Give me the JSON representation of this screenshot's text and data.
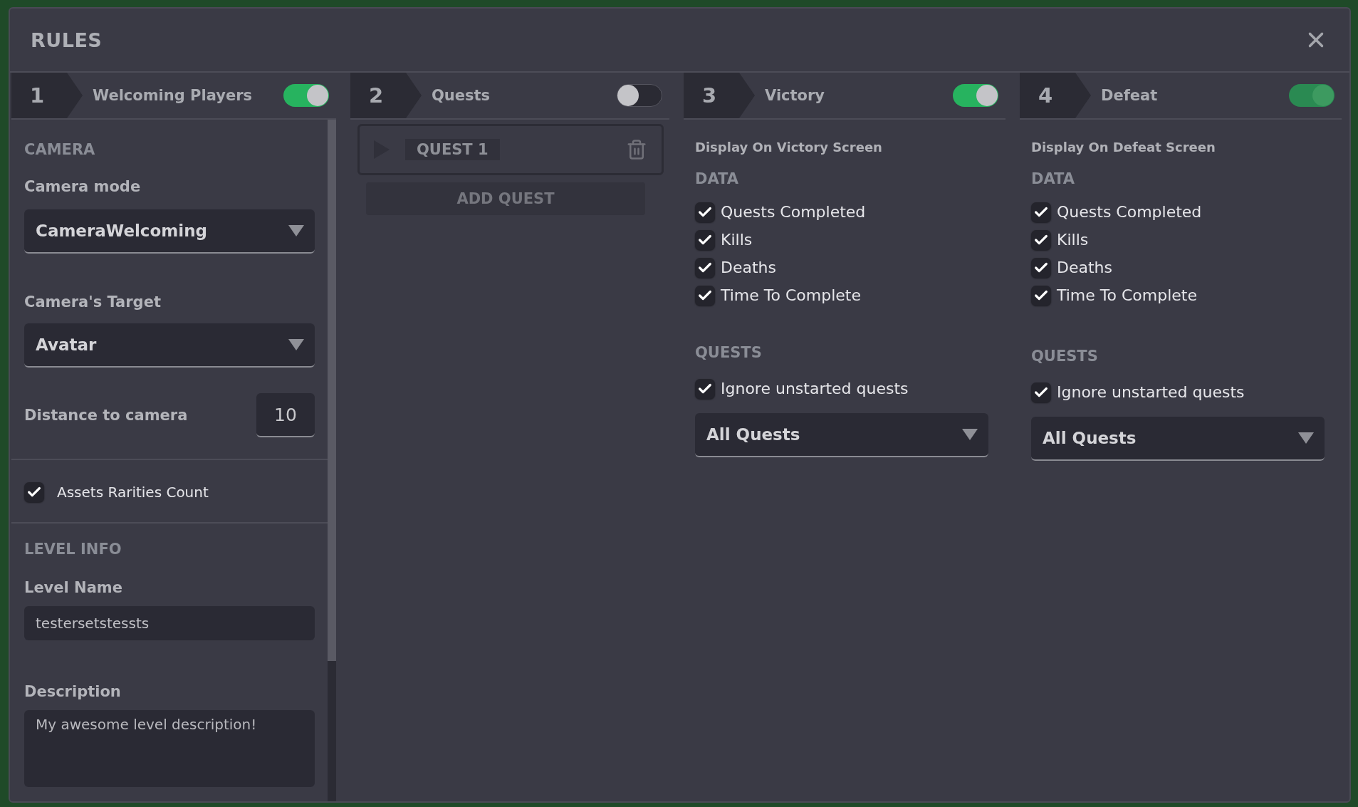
{
  "window": {
    "title": "RULES"
  },
  "steps": [
    {
      "number": "1",
      "title": "Welcoming Players",
      "on": true,
      "disabled": false,
      "kind": "welcoming",
      "panel": {
        "camera_heading": "CAMERA",
        "camera_mode": {
          "label": "Camera mode",
          "value": "CameraWelcoming"
        },
        "camera_target": {
          "label": "Camera's Target",
          "value": "Avatar"
        },
        "distance": {
          "label": "Distance to camera",
          "value": "10"
        },
        "assets_rarities": {
          "label": "Assets Rarities Count",
          "checked": true
        },
        "level_heading": "LEVEL INFO",
        "level_name": {
          "label": "Level Name",
          "value": "testersetstessts"
        },
        "description": {
          "label": "Description",
          "value": "My awesome level description!"
        }
      }
    },
    {
      "number": "2",
      "title": "Quests",
      "on": false,
      "disabled": false,
      "kind": "quests",
      "panel": {
        "quests": [
          {
            "label": "QUEST 1"
          }
        ],
        "add_button": "ADD QUEST"
      }
    },
    {
      "number": "3",
      "title": "Victory",
      "on": true,
      "disabled": false,
      "kind": "screen",
      "panel": {
        "subtitle": "Display On Victory Screen",
        "data_heading": "DATA",
        "data_options": [
          {
            "label": "Quests Completed",
            "checked": true
          },
          {
            "label": "Kills",
            "checked": true
          },
          {
            "label": "Deaths",
            "checked": true
          },
          {
            "label": "Time To Complete",
            "checked": true
          }
        ],
        "quests_heading": "QUESTS",
        "ignore_unstarted": {
          "label": "Ignore unstarted quests",
          "checked": true
        },
        "quest_filter": "All Quests"
      }
    },
    {
      "number": "4",
      "title": "Defeat",
      "on": true,
      "disabled": true,
      "kind": "screen",
      "panel": {
        "subtitle": "Display On Defeat Screen",
        "data_heading": "DATA",
        "data_options": [
          {
            "label": "Quests Completed",
            "checked": true
          },
          {
            "label": "Kills",
            "checked": true
          },
          {
            "label": "Deaths",
            "checked": true
          },
          {
            "label": "Time To Complete",
            "checked": true
          }
        ],
        "quests_heading": "QUESTS",
        "ignore_unstarted": {
          "label": "Ignore unstarted quests",
          "checked": true
        },
        "quest_filter": "All Quests"
      }
    }
  ]
}
